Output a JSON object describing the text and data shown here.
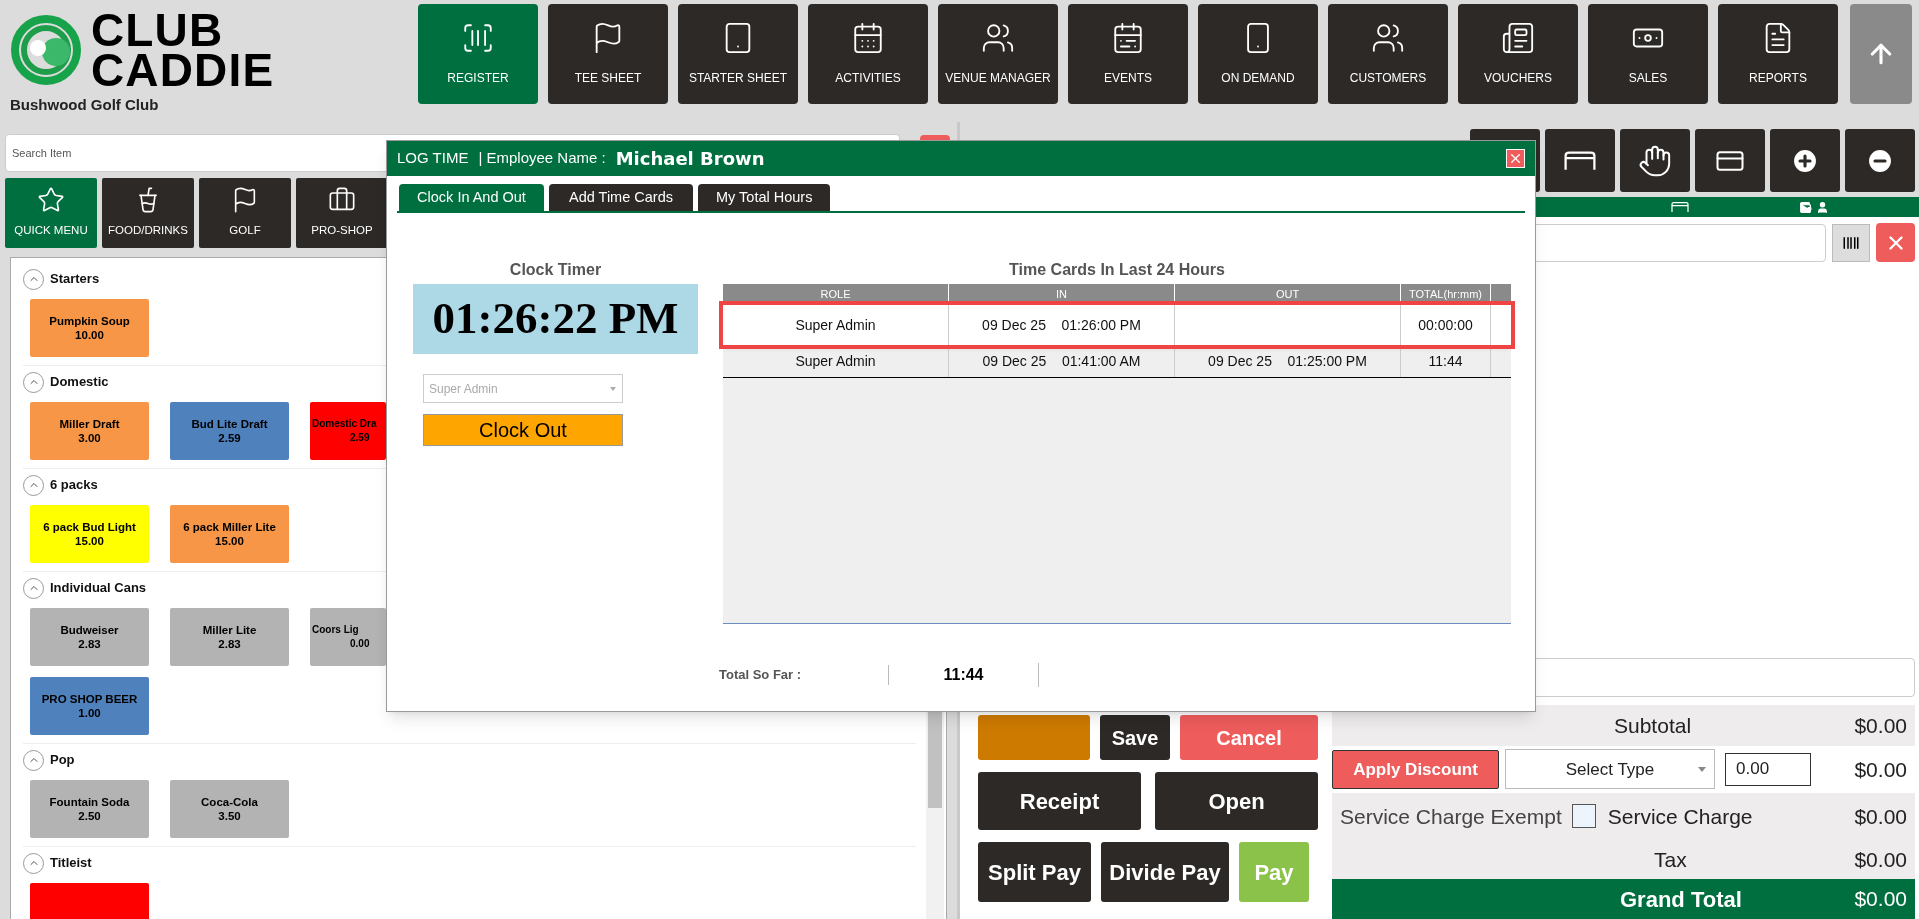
{
  "header": {
    "logo_line1": "CLUB",
    "logo_line2": "CADDIE",
    "club_name": "Bushwood Golf Club"
  },
  "nav": [
    {
      "label": "REGISTER",
      "selected": true
    },
    {
      "label": "TEE SHEET",
      "selected": false
    },
    {
      "label": "STARTER SHEET",
      "selected": false
    },
    {
      "label": "ACTIVITIES",
      "selected": false
    },
    {
      "label": "VENUE MANAGER",
      "selected": false
    },
    {
      "label": "EVENTS",
      "selected": false
    },
    {
      "label": "ON DEMAND",
      "selected": false
    },
    {
      "label": "CUSTOMERS",
      "selected": false
    },
    {
      "label": "VOUCHERS",
      "selected": false
    },
    {
      "label": "SALES",
      "selected": false
    },
    {
      "label": "REPORTS",
      "selected": false
    }
  ],
  "search": {
    "placeholder": "Search Item"
  },
  "categories": [
    {
      "label": "QUICK MENU",
      "selected": true
    },
    {
      "label": "FOOD/DRINKS",
      "selected": false
    },
    {
      "label": "GOLF",
      "selected": false
    },
    {
      "label": "PRO-SHOP",
      "selected": false
    }
  ],
  "menu_sections": [
    {
      "title": "Starters",
      "expanded": true,
      "items": [
        {
          "kind": "full",
          "name": "Pumpkin Soup",
          "price": "10.00",
          "color": "#f79646"
        }
      ]
    },
    {
      "title": "Domestic",
      "expanded": true,
      "items": [
        {
          "kind": "full",
          "name": "Miller Draft",
          "price": "3.00",
          "color": "#f79646"
        },
        {
          "kind": "full",
          "name": "Bud Lite Draft",
          "price": "2.59",
          "color": "#4f81bd"
        },
        {
          "kind": "clipped",
          "name": "Domestic Dra",
          "price": "2.59",
          "color": "#ff0000"
        }
      ]
    },
    {
      "title": "6 packs",
      "expanded": true,
      "items": [
        {
          "kind": "full",
          "name": "6 pack Bud Light",
          "price": "15.00",
          "color": "#ffff00"
        },
        {
          "kind": "full",
          "name": "6 pack Miller Lite",
          "price": "15.00",
          "color": "#f79646"
        }
      ]
    },
    {
      "title": "Individual Cans",
      "expanded": true,
      "items": [
        {
          "kind": "full",
          "name": "Budweiser",
          "price": "2.83",
          "color": "#b3b3b3"
        },
        {
          "kind": "full",
          "name": "Miller Lite",
          "price": "2.83",
          "color": "#b3b3b3"
        },
        {
          "kind": "clipped",
          "name": "Coors Lig",
          "price": "0.00",
          "color": "#b3b3b3"
        },
        {
          "kind": "full",
          "name": "PRO SHOP BEER",
          "price": "1.00",
          "color": "#4f81bd"
        }
      ]
    },
    {
      "title": "Pop",
      "expanded": true,
      "items": [
        {
          "kind": "full",
          "name": "Fountain Soda",
          "price": "2.50",
          "color": "#b3b3b3"
        },
        {
          "kind": "full",
          "name": "Coca-Cola",
          "price": "3.50",
          "color": "#b3b3b3"
        }
      ]
    },
    {
      "title": "Titleist",
      "expanded": true,
      "items": [
        {
          "kind": "full",
          "color": "#ff0000"
        }
      ]
    }
  ],
  "actions": [
    {
      "color": "#cd7a00"
    },
    {
      "label": "Save",
      "color": "#2d2926"
    },
    {
      "label": "Cancel",
      "color": "#ee5c5c"
    },
    {
      "label": "Receipt",
      "color": "#2d2926"
    },
    {
      "label": "Open",
      "color": "#2d2926"
    },
    {
      "label": "Split Pay",
      "color": "#2d2926"
    },
    {
      "label": "Divide Pay",
      "color": "#2d2926"
    },
    {
      "label": "Pay",
      "color": "#8bc34a"
    }
  ],
  "summary": {
    "subtotal": {
      "label": "Subtotal",
      "amount": "$0.00"
    },
    "discount": {
      "button": "Apply Discount",
      "type": "Select Type",
      "value": "0.00",
      "amount": "$0.00"
    },
    "service": {
      "exempt_label": "Service Charge Exempt",
      "exempt_checked": false,
      "label": "Service Charge",
      "amount": "$0.00"
    },
    "tax": {
      "label": "Tax",
      "amount": "$0.00"
    },
    "grand_total": {
      "label": "Grand Total",
      "amount": "$0.00"
    }
  },
  "modal": {
    "title": "LOG TIME",
    "employee_label": "| Employee Name :",
    "employee_name": "Michael Brown",
    "tabs": [
      {
        "label": "Clock In And Out",
        "selected": true
      },
      {
        "label": "Add Time Cards",
        "selected": false
      },
      {
        "label": "My Total Hours",
        "selected": false
      }
    ],
    "clock": {
      "title": "Clock Timer",
      "time": "01:26:22 PM",
      "role": "Super Admin",
      "role_disabled": true,
      "button": "Clock Out"
    },
    "table": {
      "title": "Time Cards In Last 24 Hours",
      "columns": [
        "ROLE",
        "IN",
        "OUT",
        "TOTAL(hr:mm)"
      ],
      "rows": [
        {
          "role": "Super Admin",
          "in": "09 Dec 25    01:26:00 PM",
          "total": "00:00:00",
          "selected": true
        },
        {
          "role": "Super Admin",
          "in": "09 Dec 25    01:41:00 AM",
          "out": "09 Dec 25    01:25:00 PM",
          "total": "11:44",
          "selected": false
        }
      ]
    },
    "total_label": "Total So Far :",
    "total": "11:44"
  }
}
